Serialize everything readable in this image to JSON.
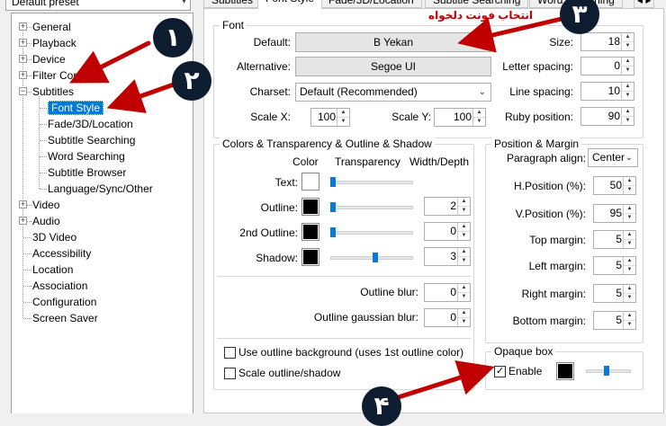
{
  "preset": {
    "value": "Default preset"
  },
  "tree": {
    "items": [
      {
        "label": "General",
        "expander": "+"
      },
      {
        "label": "Playback",
        "expander": "+"
      },
      {
        "label": "Device",
        "expander": "+"
      },
      {
        "label": "Filter Control",
        "expander": "+"
      },
      {
        "label": "Subtitles",
        "expander": "−"
      },
      {
        "label": "Font Style",
        "selected": true
      },
      {
        "label": "Fade/3D/Location"
      },
      {
        "label": "Subtitle Searching"
      },
      {
        "label": "Word Searching"
      },
      {
        "label": "Subtitle Browser"
      },
      {
        "label": "Language/Sync/Other"
      },
      {
        "label": "Video",
        "expander": "+"
      },
      {
        "label": "Audio",
        "expander": "+"
      },
      {
        "label": "3D Video"
      },
      {
        "label": "Accessibility"
      },
      {
        "label": "Location"
      },
      {
        "label": "Association"
      },
      {
        "label": "Configuration"
      },
      {
        "label": "Screen Saver"
      }
    ]
  },
  "tabs": [
    "Subtitles",
    "Font Style",
    "Fade/3D/Location",
    "Subtitle Searching",
    "Word Searching"
  ],
  "font": {
    "title": "Font",
    "default_label": "Default:",
    "default_value": "B Yekan",
    "alternative_label": "Alternative:",
    "alternative_value": "Segoe UI",
    "charset_label": "Charset:",
    "charset_value": "Default (Recommended)",
    "scalex_label": "Scale X:",
    "scalex_value": "100",
    "scaley_label": "Scale Y:",
    "scaley_value": "100",
    "size_label": "Size:",
    "size_value": "18",
    "letter_label": "Letter spacing:",
    "letter_value": "0",
    "line_label": "Line spacing:",
    "line_value": "10",
    "ruby_label": "Ruby position:",
    "ruby_value": "90"
  },
  "colors": {
    "title": "Colors & Transparency & Outline & Shadow",
    "col_color": "Color",
    "col_transparency": "Transparency",
    "col_width": "Width/Depth",
    "text_label": "Text:",
    "text_color": "#ffffff",
    "text_transparency": 0,
    "outline_label": "Outline:",
    "outline_color": "#000000",
    "outline_transparency": 0,
    "outline_width": "2",
    "outline2_label": "2nd Outline:",
    "outline2_color": "#000000",
    "outline2_transparency": 0,
    "outline2_width": "0",
    "shadow_label": "Shadow:",
    "shadow_color": "#000000",
    "shadow_transparency": 0.55,
    "shadow_width": "3",
    "blur_label": "Outline blur:",
    "blur_value": "0",
    "gblur_label": "Outline gaussian blur:",
    "gblur_value": "0",
    "use_bg_label": "Use outline background (uses 1st outline color)",
    "scale_label": "Scale outline/shadow"
  },
  "position": {
    "title": "Position & Margin",
    "align_label": "Paragraph align:",
    "align_value": "Center",
    "hpos_label": "H.Position (%):",
    "hpos_value": "50",
    "vpos_label": "V.Position (%):",
    "vpos_value": "95",
    "top_label": "Top margin:",
    "top_value": "5",
    "left_label": "Left margin:",
    "left_value": "5",
    "right_label": "Right margin:",
    "right_value": "5",
    "bottom_label": "Bottom margin:",
    "bottom_value": "5"
  },
  "opaque": {
    "title": "Opaque box",
    "enable_label": "Enable",
    "enabled": true,
    "color": "#000000",
    "transparency": 0.45
  },
  "annotations": {
    "badges": [
      "١",
      "٢",
      "٣",
      "۴"
    ],
    "note": "انتخاب فونت دلخواه",
    "arrow_color": "#c00000"
  }
}
